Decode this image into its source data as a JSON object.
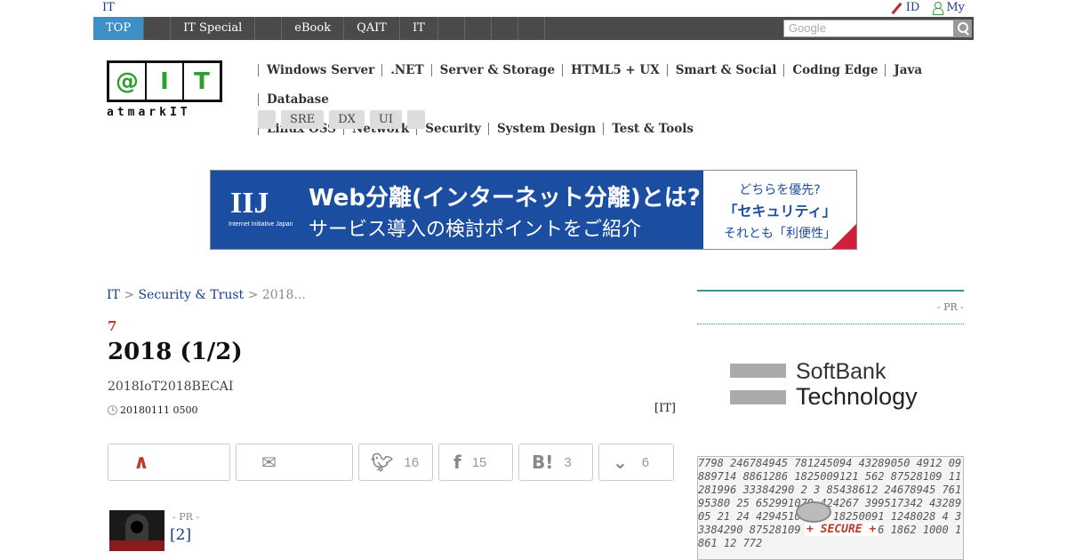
{
  "util": {
    "left_label": "IT",
    "id_label": "ID",
    "my_label": "My"
  },
  "nav": {
    "items": [
      "TOP",
      "",
      "IT Special",
      "",
      "eBook",
      "QAIT",
      "IT",
      "",
      "",
      "",
      ""
    ],
    "search_placeholder": "Google"
  },
  "logo": {
    "cells": [
      "@",
      "I",
      "T"
    ],
    "sub": "atmarkIT"
  },
  "categories": [
    "Windows Server",
    ".NET",
    "Server & Storage",
    "HTML5 + UX",
    "Smart & Social",
    "Coding Edge",
    "Java",
    "Database",
    "Linux  OSS",
    "Network",
    "Security",
    "System Design",
    "Test & Tools"
  ],
  "tags": [
    "",
    "SRE",
    "DX",
    "UI",
    ""
  ],
  "banner": {
    "brand": "IIJ",
    "brand_sub": "Internet Initiative Japan",
    "line1": "Web分離(インターネット分離)とは?",
    "line2": "サービス導入の検討ポイントをご紹介",
    "side1": "どちらを優先?",
    "side2": "「セキュリティ」",
    "side3": "それとも「利便性」"
  },
  "breadcrumb": {
    "root": "IT",
    "sep": ">",
    "section": "Security & Trust",
    "current": "2018..."
  },
  "article": {
    "kicker": "7",
    "title": "2018 (1/2)",
    "deck": "2018IoT2018BECAI",
    "date": "20180111 0500",
    "source": "[IT]"
  },
  "share": {
    "twitter": "16",
    "facebook": "15",
    "hatena": "3",
    "pocket": "6"
  },
  "pr": {
    "label": "- PR -",
    "link": "[2]"
  },
  "sidebar": {
    "pr_label": "- PR -",
    "ad_line1": "SoftBank",
    "ad_line2": "Technology",
    "secure_label": "+ SECURE +",
    "digits": "7798 246784945 781245094 43289050 4912 09889714 8861286 1825009121 562 87528109 11281996 33384290 2 3 85438612 24678945 76195380 25 652991079 424267 399517342 4328905 21 24 429451004 9 18250091 1248028 4 33384290 87528109 77209512 176 1862 1000 1861 12 772"
  }
}
